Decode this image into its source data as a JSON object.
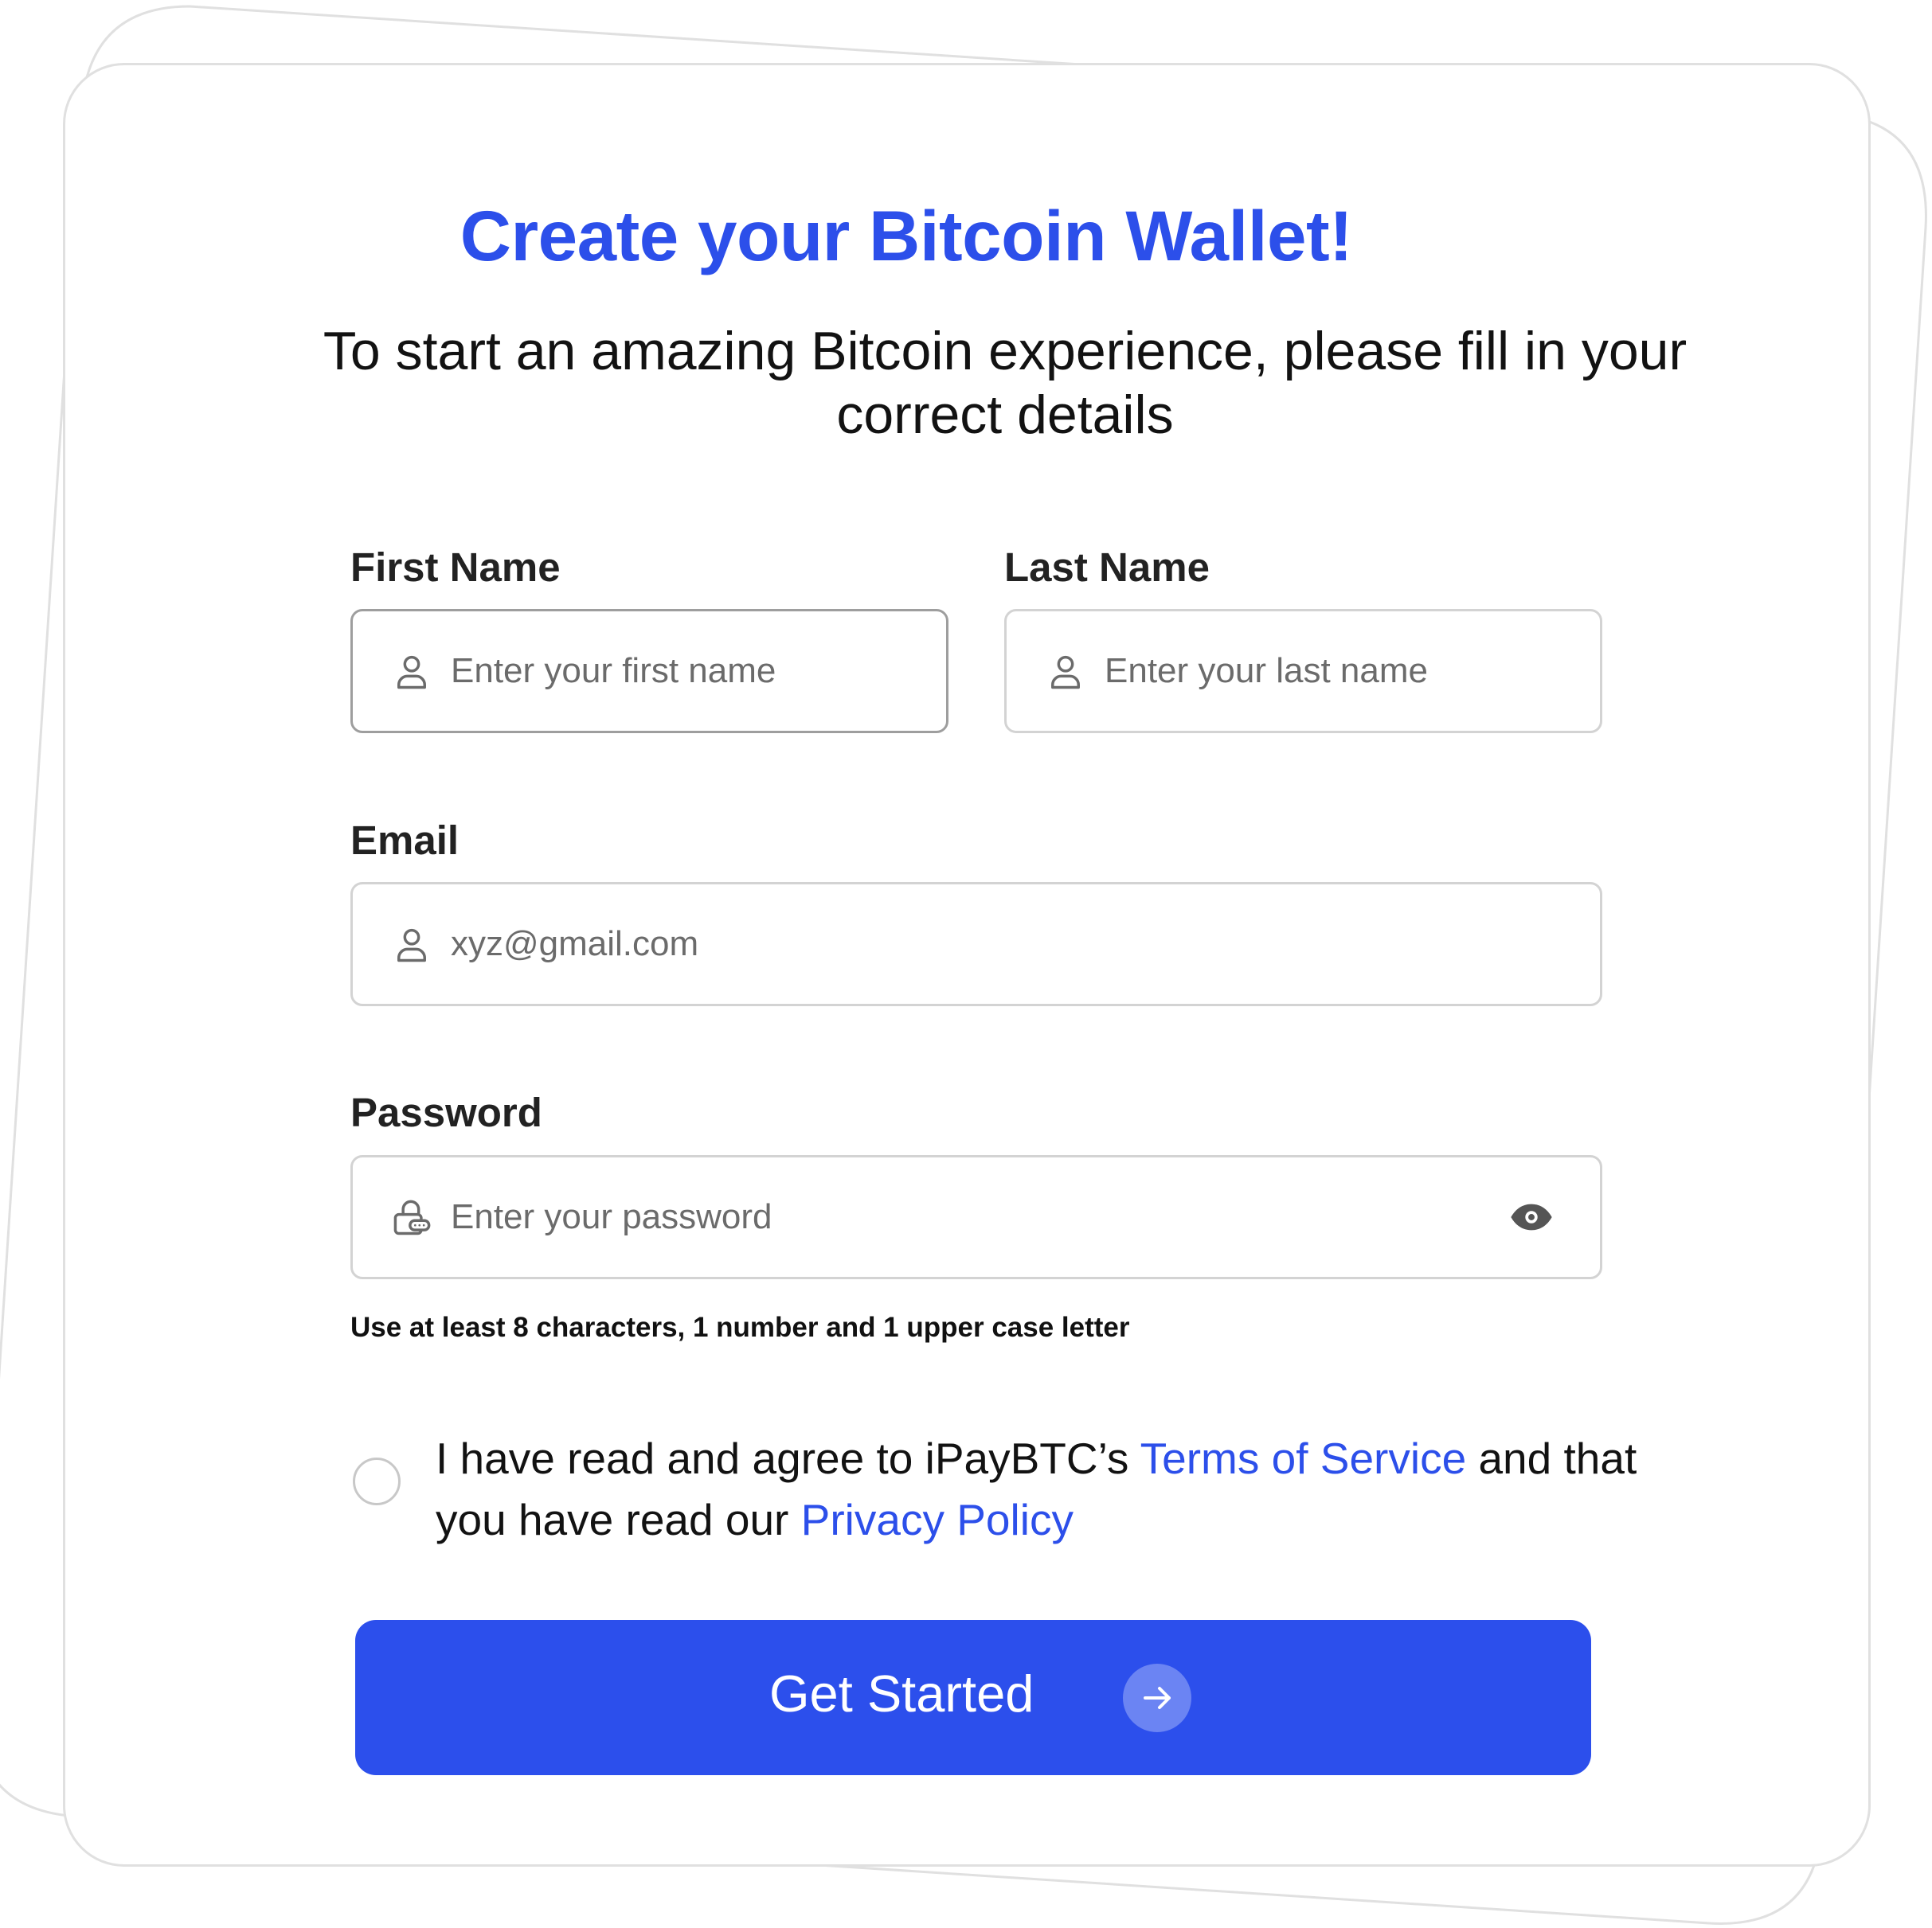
{
  "form": {
    "title": "Create your Bitcoin Wallet!",
    "subtitle": "To start an amazing Bitcoin experience, please fill in your correct details",
    "first_name": {
      "label": "First Name",
      "value": "",
      "placeholder": "Enter your first name",
      "icon": "user-icon"
    },
    "last_name": {
      "label": "Last Name",
      "value": "",
      "placeholder": "Enter your last name",
      "icon": "user-icon"
    },
    "email": {
      "label": "Email",
      "value": "",
      "placeholder": "xyz@gmail.com",
      "icon": "user-icon"
    },
    "password": {
      "label": "Password",
      "value": "",
      "placeholder": "Enter your password",
      "icon": "lock-icon",
      "toggle_icon": "eye-icon",
      "hint": "Use at least 8 characters, 1 number and 1 upper case letter"
    },
    "agreement": {
      "checked": false,
      "text_before": "I have read and agree to iPayBTC’s ",
      "terms_link": "Terms of Service",
      "text_middle": " and that you have read our ",
      "privacy_link": "Privacy Policy"
    },
    "submit": {
      "label": "Get Started",
      "icon": "arrow-right-icon"
    }
  },
  "colors": {
    "accent": "#2c4fea",
    "button": "#2c4fec",
    "text": "#121212",
    "border": "#d3d3d3",
    "border_focused": "#9e9e9e",
    "icon": "#6b6b6b"
  }
}
